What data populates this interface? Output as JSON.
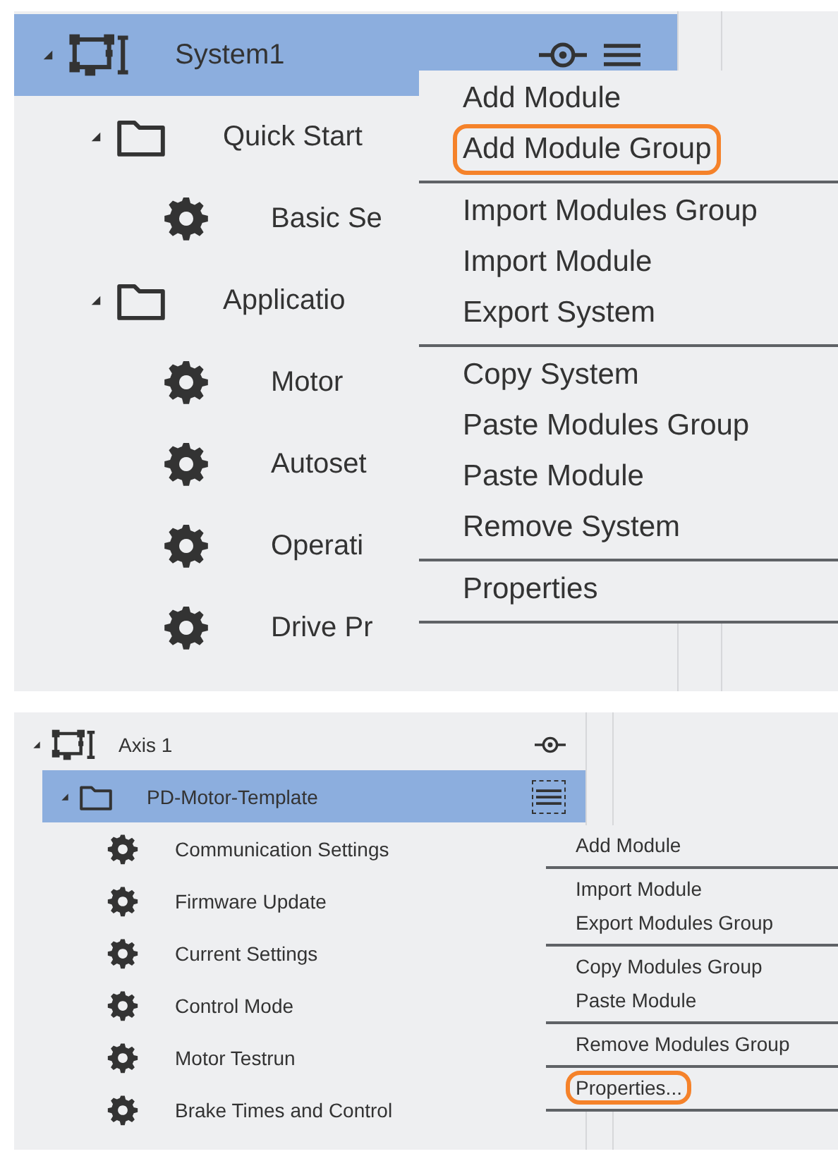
{
  "panels": [
    {
      "kind": "large",
      "tree": [
        {
          "kind": "system",
          "label": "System1",
          "expanded": true,
          "selected": true,
          "icons": [
            {
              "kind": "locate",
              "focused": false
            },
            {
              "kind": "menu",
              "focused": false
            }
          ],
          "children": [
            {
              "kind": "folder",
              "label": "Quick Start",
              "expanded": true,
              "selected": false,
              "children": [
                {
                  "kind": "module",
                  "label": "Basic Se",
                  "selected": false
                }
              ]
            },
            {
              "kind": "folder",
              "label": "Applicatio",
              "expanded": true,
              "selected": false,
              "children": [
                {
                  "kind": "module",
                  "label": "Motor",
                  "selected": false
                },
                {
                  "kind": "module",
                  "label": "Autoset",
                  "selected": false
                },
                {
                  "kind": "module",
                  "label": "Operati",
                  "selected": false
                },
                {
                  "kind": "module",
                  "label": "Drive Pr",
                  "selected": false
                }
              ]
            }
          ]
        }
      ],
      "menu": {
        "groups": [
          [
            {
              "label": "Add Module",
              "circled": false
            },
            {
              "label": "Add Module Group",
              "circled": true
            }
          ],
          [
            {
              "label": "Import Modules Group",
              "circled": false
            },
            {
              "label": "Import Module",
              "circled": false
            },
            {
              "label": "Export System",
              "circled": false
            }
          ],
          [
            {
              "label": "Copy System",
              "circled": false
            },
            {
              "label": "Paste Modules Group",
              "circled": false
            },
            {
              "label": "Paste Module",
              "circled": false
            },
            {
              "label": "Remove System",
              "circled": false
            }
          ],
          [
            {
              "label": "Properties",
              "circled": false
            }
          ]
        ]
      }
    },
    {
      "kind": "small",
      "tree": [
        {
          "kind": "system",
          "label": "Axis 1",
          "expanded": true,
          "selected": false,
          "icons": [
            {
              "kind": "locate",
              "focused": false
            }
          ],
          "children": [
            {
              "kind": "folder",
              "label": "PD-Motor-Template",
              "expanded": true,
              "selected": true,
              "icons": [
                {
                  "kind": "menu",
                  "focused": true
                }
              ],
              "children": [
                {
                  "kind": "module",
                  "label": "Communication Settings",
                  "selected": false
                },
                {
                  "kind": "module",
                  "label": "Firmware Update",
                  "selected": false
                },
                {
                  "kind": "module",
                  "label": "Current Settings",
                  "selected": false
                },
                {
                  "kind": "module",
                  "label": "Control Mode",
                  "selected": false
                },
                {
                  "kind": "module",
                  "label": "Motor Testrun",
                  "selected": false
                },
                {
                  "kind": "module",
                  "label": "Brake Times and Control",
                  "selected": false
                }
              ]
            }
          ]
        }
      ],
      "menu": {
        "groups": [
          [
            {
              "label": "Add Module",
              "circled": false
            }
          ],
          [
            {
              "label": "Import Module",
              "circled": false
            },
            {
              "label": "Export Modules Group",
              "circled": false
            }
          ],
          [
            {
              "label": "Copy Modules Group",
              "circled": false
            },
            {
              "label": "Paste Module",
              "circled": false
            }
          ],
          [
            {
              "label": "Remove Modules Group",
              "circled": false
            }
          ],
          [
            {
              "label": "Properties...",
              "circled": true
            }
          ]
        ]
      }
    }
  ]
}
